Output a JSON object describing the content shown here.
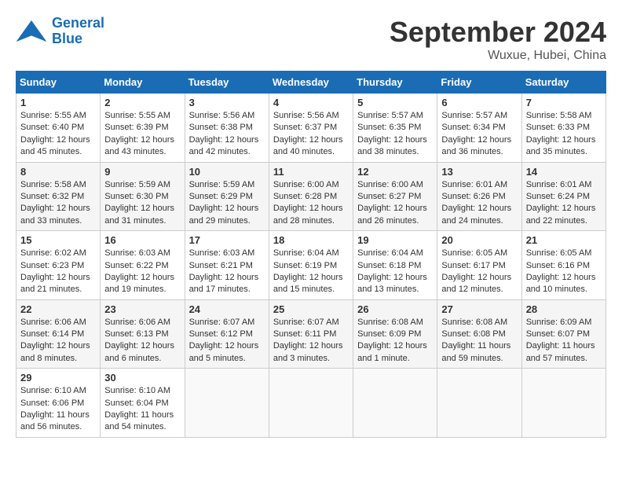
{
  "header": {
    "logo": {
      "line1": "General",
      "line2": "Blue"
    },
    "title": "September 2024",
    "location": "Wuxue, Hubei, China"
  },
  "calendar": {
    "weekdays": [
      "Sunday",
      "Monday",
      "Tuesday",
      "Wednesday",
      "Thursday",
      "Friday",
      "Saturday"
    ],
    "weeks": [
      [
        {
          "day": "1",
          "sunrise": "5:55 AM",
          "sunset": "6:40 PM",
          "daylight": "12 hours and 45 minutes."
        },
        {
          "day": "2",
          "sunrise": "5:55 AM",
          "sunset": "6:39 PM",
          "daylight": "12 hours and 43 minutes."
        },
        {
          "day": "3",
          "sunrise": "5:56 AM",
          "sunset": "6:38 PM",
          "daylight": "12 hours and 42 minutes."
        },
        {
          "day": "4",
          "sunrise": "5:56 AM",
          "sunset": "6:37 PM",
          "daylight": "12 hours and 40 minutes."
        },
        {
          "day": "5",
          "sunrise": "5:57 AM",
          "sunset": "6:35 PM",
          "daylight": "12 hours and 38 minutes."
        },
        {
          "day": "6",
          "sunrise": "5:57 AM",
          "sunset": "6:34 PM",
          "daylight": "12 hours and 36 minutes."
        },
        {
          "day": "7",
          "sunrise": "5:58 AM",
          "sunset": "6:33 PM",
          "daylight": "12 hours and 35 minutes."
        }
      ],
      [
        {
          "day": "8",
          "sunrise": "5:58 AM",
          "sunset": "6:32 PM",
          "daylight": "12 hours and 33 minutes."
        },
        {
          "day": "9",
          "sunrise": "5:59 AM",
          "sunset": "6:30 PM",
          "daylight": "12 hours and 31 minutes."
        },
        {
          "day": "10",
          "sunrise": "5:59 AM",
          "sunset": "6:29 PM",
          "daylight": "12 hours and 29 minutes."
        },
        {
          "day": "11",
          "sunrise": "6:00 AM",
          "sunset": "6:28 PM",
          "daylight": "12 hours and 28 minutes."
        },
        {
          "day": "12",
          "sunrise": "6:00 AM",
          "sunset": "6:27 PM",
          "daylight": "12 hours and 26 minutes."
        },
        {
          "day": "13",
          "sunrise": "6:01 AM",
          "sunset": "6:26 PM",
          "daylight": "12 hours and 24 minutes."
        },
        {
          "day": "14",
          "sunrise": "6:01 AM",
          "sunset": "6:24 PM",
          "daylight": "12 hours and 22 minutes."
        }
      ],
      [
        {
          "day": "15",
          "sunrise": "6:02 AM",
          "sunset": "6:23 PM",
          "daylight": "12 hours and 21 minutes."
        },
        {
          "day": "16",
          "sunrise": "6:03 AM",
          "sunset": "6:22 PM",
          "daylight": "12 hours and 19 minutes."
        },
        {
          "day": "17",
          "sunrise": "6:03 AM",
          "sunset": "6:21 PM",
          "daylight": "12 hours and 17 minutes."
        },
        {
          "day": "18",
          "sunrise": "6:04 AM",
          "sunset": "6:19 PM",
          "daylight": "12 hours and 15 minutes."
        },
        {
          "day": "19",
          "sunrise": "6:04 AM",
          "sunset": "6:18 PM",
          "daylight": "12 hours and 13 minutes."
        },
        {
          "day": "20",
          "sunrise": "6:05 AM",
          "sunset": "6:17 PM",
          "daylight": "12 hours and 12 minutes."
        },
        {
          "day": "21",
          "sunrise": "6:05 AM",
          "sunset": "6:16 PM",
          "daylight": "12 hours and 10 minutes."
        }
      ],
      [
        {
          "day": "22",
          "sunrise": "6:06 AM",
          "sunset": "6:14 PM",
          "daylight": "12 hours and 8 minutes."
        },
        {
          "day": "23",
          "sunrise": "6:06 AM",
          "sunset": "6:13 PM",
          "daylight": "12 hours and 6 minutes."
        },
        {
          "day": "24",
          "sunrise": "6:07 AM",
          "sunset": "6:12 PM",
          "daylight": "12 hours and 5 minutes."
        },
        {
          "day": "25",
          "sunrise": "6:07 AM",
          "sunset": "6:11 PM",
          "daylight": "12 hours and 3 minutes."
        },
        {
          "day": "26",
          "sunrise": "6:08 AM",
          "sunset": "6:09 PM",
          "daylight": "12 hours and 1 minute."
        },
        {
          "day": "27",
          "sunrise": "6:08 AM",
          "sunset": "6:08 PM",
          "daylight": "11 hours and 59 minutes."
        },
        {
          "day": "28",
          "sunrise": "6:09 AM",
          "sunset": "6:07 PM",
          "daylight": "11 hours and 57 minutes."
        }
      ],
      [
        {
          "day": "29",
          "sunrise": "6:10 AM",
          "sunset": "6:06 PM",
          "daylight": "11 hours and 56 minutes."
        },
        {
          "day": "30",
          "sunrise": "6:10 AM",
          "sunset": "6:04 PM",
          "daylight": "11 hours and 54 minutes."
        },
        null,
        null,
        null,
        null,
        null
      ]
    ]
  }
}
